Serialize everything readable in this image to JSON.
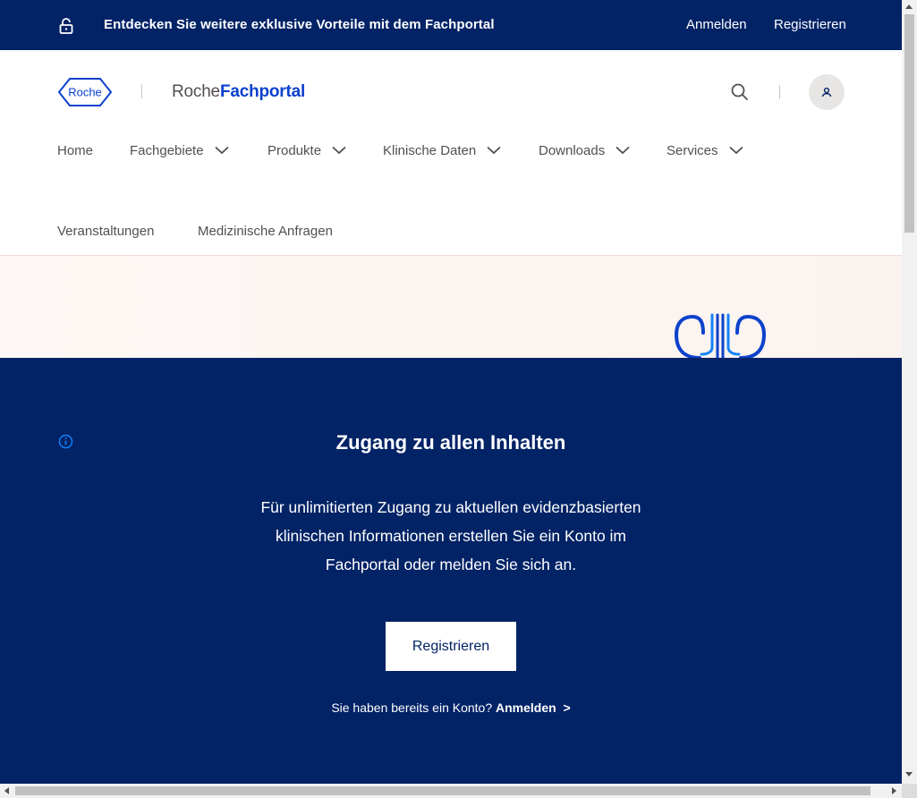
{
  "topbar": {
    "lock_icon": "unlock-icon",
    "promo_text": "Entdecken Sie weitere exklusive Vorteile mit dem Fachportal",
    "login_label": "Anmelden",
    "register_label": "Registrieren"
  },
  "header": {
    "logo_text": "Roche",
    "brand_prefix": "Roche",
    "brand_name": "Fachportal",
    "search_icon": "search-icon",
    "account_icon": "user-icon"
  },
  "nav": {
    "items": [
      {
        "label": "Home"
      },
      {
        "label": "Fachgebiete"
      },
      {
        "label": "Produkte"
      },
      {
        "label": "Klinische Daten"
      },
      {
        "label": "Downloads"
      },
      {
        "label": "Services"
      },
      {
        "label": "Veranstaltungen"
      },
      {
        "label": "Medizinische Anfragen"
      }
    ]
  },
  "overlay": {
    "info_icon": "info-icon",
    "title": "Zugang zu allen Inhalten",
    "body_line1": "Für unlimitierten Zugang zu aktuellen evidenzbasierten",
    "body_line2": "klinischen Informationen erstellen Sie ein Konto im",
    "body_line3": "Fachportal oder melden Sie sich an.",
    "register_button": "Registrieren",
    "account_question": "Sie haben bereits ein Konto?",
    "login_link": "Anmelden",
    "login_arrow": ">"
  },
  "colors": {
    "navy": "#022366",
    "brand_blue": "#0b41cd",
    "nav_text": "#544f4f",
    "hero_bg": "#fbf3ef"
  }
}
